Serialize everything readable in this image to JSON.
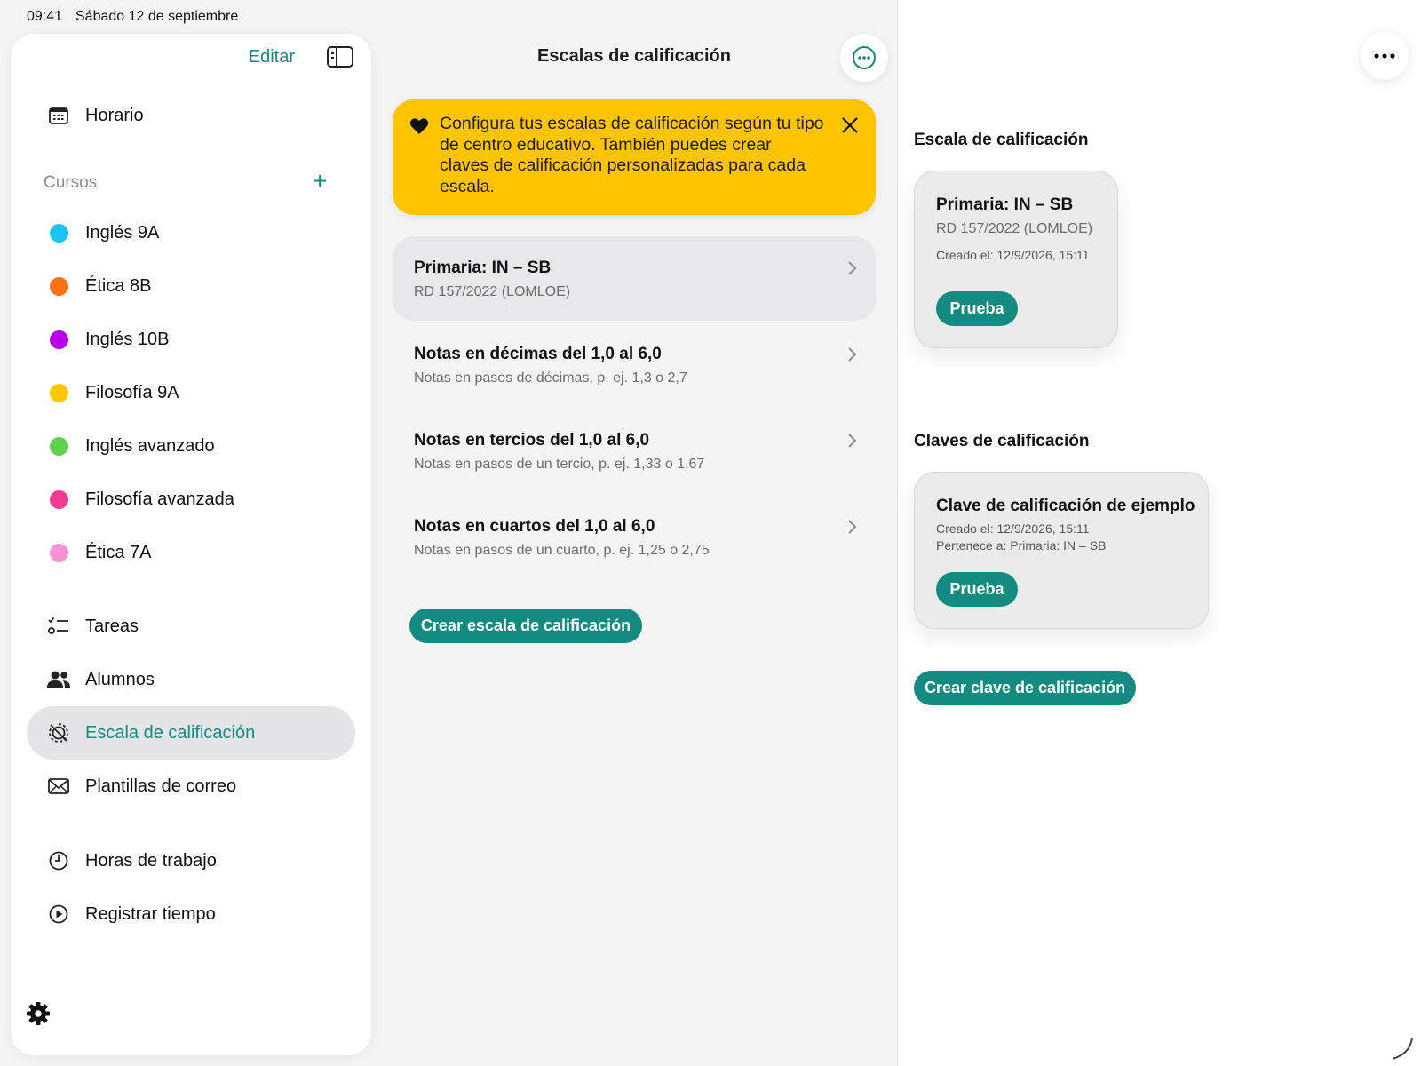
{
  "status_bar": {
    "time": "09:41",
    "date": "Sábado 12 de septiembre"
  },
  "sidebar": {
    "edit_label": "Editar",
    "schedule_label": "Horario",
    "courses_label": "Cursos",
    "courses": [
      {
        "label": "Inglés 9A",
        "color": "#1cc1f5"
      },
      {
        "label": "Ética 8B",
        "color": "#fa7314"
      },
      {
        "label": "Inglés 10B",
        "color": "#b700ee"
      },
      {
        "label": "Filosofía 9A",
        "color": "#ffc700"
      },
      {
        "label": "Inglés avanzado",
        "color": "#5fd04f"
      },
      {
        "label": "Filosofía avanzada",
        "color": "#f23b91"
      },
      {
        "label": "Ética 7A",
        "color": "#f891d5"
      }
    ],
    "tools": {
      "tasks": "Tareas",
      "students": "Alumnos",
      "grading_scale": "Escala de calificación",
      "email_templates": "Plantillas de correo",
      "working_hours": "Horas de trabajo",
      "track_time": "Registrar tiempo"
    }
  },
  "middle": {
    "title": "Escalas de calificación",
    "banner_text": "Configura tus escalas de calificación según tu tipo de centro educativo. También puedes crear claves de calificación personalizadas para cada escala.",
    "scales": [
      {
        "title": "Primaria: IN – SB",
        "subtitle": "RD 157/2022 (LOMLOE)"
      },
      {
        "title": "Notas en décimas del 1,0 al 6,0",
        "subtitle": "Notas en pasos de décimas, p. ej. 1,3 o 2,7"
      },
      {
        "title": "Notas en tercios del 1,0 al 6,0",
        "subtitle": "Notas en pasos de un tercio, p. ej. 1,33 o 1,67"
      },
      {
        "title": "Notas en cuartos del 1,0 al 6,0",
        "subtitle": "Notas en pasos de un cuarto, p. ej. 1,25 o 2,75"
      }
    ],
    "create_scale_label": "Crear escala de calificación"
  },
  "detail": {
    "scale_heading": "Escala de calificación",
    "scale_card": {
      "title": "Primaria: IN – SB",
      "subtitle": "RD 157/2022 (LOMLOE)",
      "created": "Creado el: 12/9/2026, 15:11",
      "badge": "Prueba"
    },
    "keys_heading": "Claves de calificación",
    "key_card": {
      "title": "Clave de calificación de ejemplo",
      "created": "Creado el: 12/9/2026, 15:11",
      "belongs": "Pertenece a: Primaria: IN – SB",
      "badge": "Prueba"
    },
    "create_key_label": "Crear clave de calificación"
  },
  "colors": {
    "accent": "#138b80",
    "banner": "#ffc400",
    "selected_row": "#e8e8ea"
  },
  "icons": [
    "calendar-icon",
    "plus-icon",
    "tasks-icon",
    "students-icon",
    "grading-scale-icon",
    "mail-icon",
    "clock-icon",
    "play-icon",
    "gear-icon",
    "heart-icon",
    "close-icon",
    "chevron-right-icon",
    "more-icon",
    "sidebar-toggle-icon"
  ]
}
